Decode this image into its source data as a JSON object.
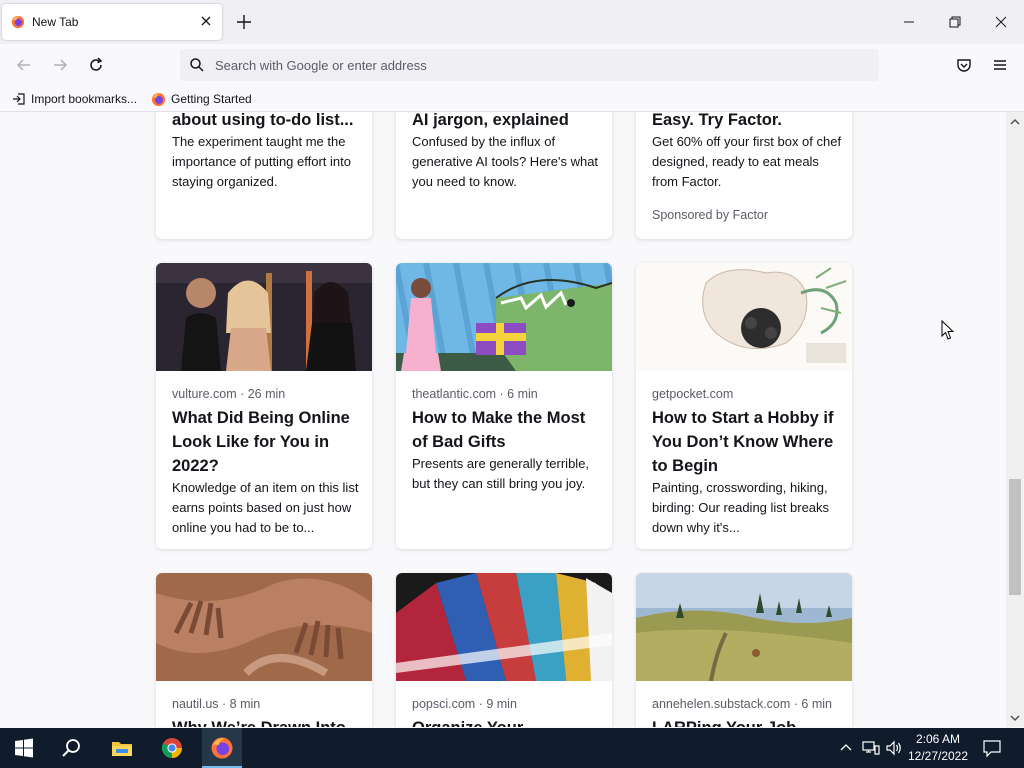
{
  "browser": {
    "tab_title": "New Tab",
    "urlbar_placeholder": "Search with Google or enter address"
  },
  "bookmarks": [
    {
      "label": "Import bookmarks..."
    },
    {
      "label": "Getting Started"
    }
  ],
  "cards": [
    {
      "headline": "about using to-do list...",
      "excerpt": "The experiment taught me the importance of putting effort into staying organized."
    },
    {
      "headline": "AI jargon, explained",
      "excerpt": "Confused by the influx of generative AI tools? Here's what you need to know."
    },
    {
      "headline": "Easy. Try Factor.",
      "excerpt": "Get 60% off your first box of chef designed, ready to eat meals from Factor.",
      "sponsor": "Sponsored by Factor"
    },
    {
      "source": "vulture.com · 26 min",
      "headline": "What Did Being Online Look Like for You in 2022?",
      "excerpt": "Knowledge of an item on this list earns points based on just how online you had to be to..."
    },
    {
      "source": "theatlantic.com · 6 min",
      "headline": "How to Make the Most of Bad Gifts",
      "excerpt": "Presents are generally terrible, but they can still bring you joy."
    },
    {
      "source": "getpocket.com",
      "headline": "How to Start a Hobby if You Don’t Know Where to Begin",
      "excerpt": "Painting, crosswording, hiking, birding: Our reading list breaks down why it's..."
    },
    {
      "source": "nautil.us · 8 min",
      "headline": "Why We’re Drawn Into"
    },
    {
      "source": "popsci.com · 9 min",
      "headline": "Organize Your"
    },
    {
      "source": "annehelen.substack.com · 6 min",
      "headline": "LARPing Your Job"
    }
  ],
  "taskbar": {
    "time": "2:06 AM",
    "date": "12/27/2022"
  },
  "colors": {
    "accent": "#0061e0",
    "taskbar": "#101c2b",
    "tabstrip": "#f0f0f4"
  }
}
